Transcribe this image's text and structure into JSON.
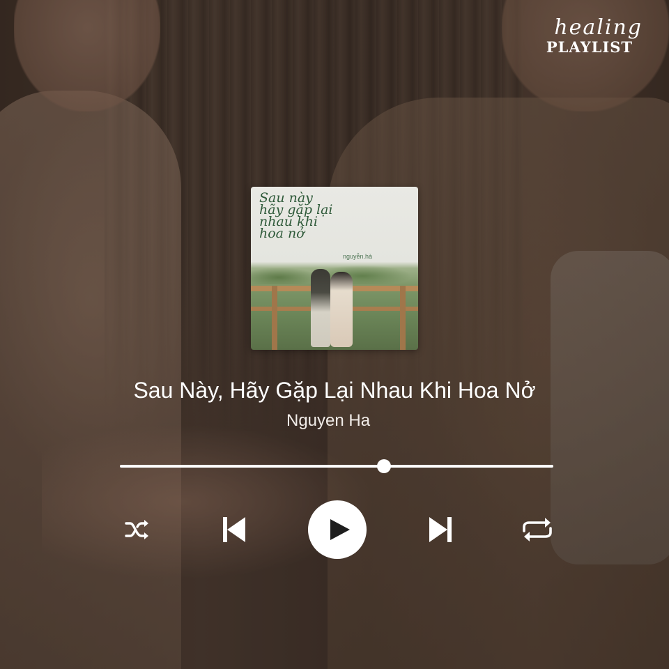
{
  "brand": {
    "script": "healing",
    "caps": "PLAYLIST"
  },
  "album": {
    "cover_title_lines": [
      "Sau này",
      "hãy gặp lại",
      "nhau khi",
      "hoa nở"
    ],
    "cover_artist": "nguyễn.hà"
  },
  "track": {
    "title": "Sau Này, Hãy Gặp Lại Nhau Khi Hoa Nở",
    "artist": "Nguyen Ha",
    "progress": 0.61
  },
  "controls": {
    "shuffle_icon": "shuffle-icon",
    "previous_icon": "skip-previous-icon",
    "play_icon": "play-icon",
    "next_icon": "skip-next-icon",
    "repeat_icon": "repeat-icon"
  },
  "colors": {
    "foreground": "#ffffff",
    "album_text": "#2f5a3a"
  }
}
